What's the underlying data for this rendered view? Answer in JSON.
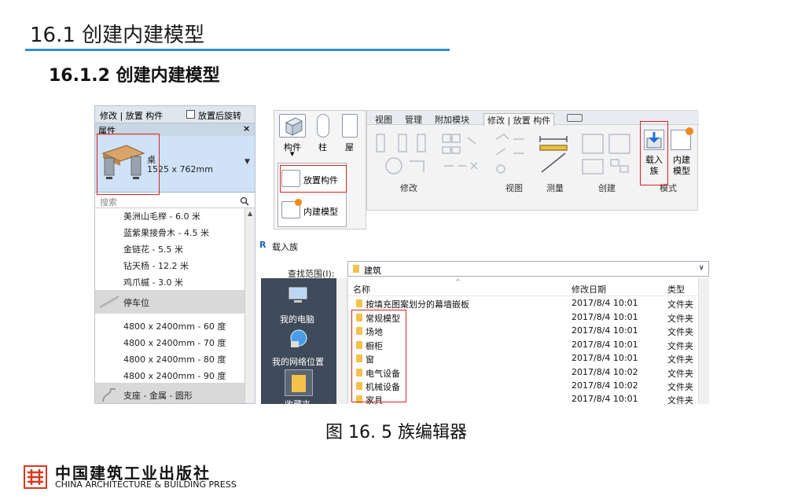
{
  "slide": {
    "title": "16.1 创建内建模型",
    "subtitle": "16.1.2 创建内建模型",
    "caption": "图 16. 5 族编辑器"
  },
  "props_panel": {
    "tab_label": "修改 | 放置 构件",
    "rotate_checkbox": "放置后旋转",
    "header": "属性",
    "close": "×",
    "type_name": "桌",
    "type_size": "1525 x 762mm",
    "search_placeholder": "搜索",
    "plants": [
      "美洲山毛榉 - 6.0 米",
      "蓝紫果接骨木 - 4.5 米",
      "金链花 - 5.5 米",
      "钻天杨 - 12.2 米",
      "鸡爪槭 - 3.0 米"
    ],
    "group_parking": "停车位",
    "parking": [
      "4800 x 2400mm - 60 度",
      "4800 x 2400mm - 70 度",
      "4800 x 2400mm - 80 度",
      "4800 x 2400mm - 90 度"
    ],
    "group_toilet": "支座 - 金属 - 圆形"
  },
  "ribbon_small": {
    "component": "构件",
    "column": "柱",
    "third": "屋",
    "place_component": "放置构件",
    "inplace_model": "内建模型"
  },
  "ribbon_main": {
    "tabs": [
      "视图",
      "管理",
      "附加模块",
      "修改 | 放置 构件"
    ],
    "groups": [
      "修改",
      "视图",
      "测量",
      "创建",
      "模式"
    ],
    "load_family": "载入族",
    "inplace_model": "内建模型"
  },
  "dialog": {
    "icon": "R",
    "title": "载入族",
    "lookin_label": "查找范围(I):",
    "lookin_value": "建筑",
    "places": [
      "我的电脑",
      "我的网络位置",
      "收藏夹"
    ],
    "columns": [
      "名称",
      "修改日期",
      "类型"
    ],
    "rows": [
      {
        "name": "按填充图案划分的幕墙嵌板",
        "date": "2017/8/4 10:01",
        "type": "文件夹"
      },
      {
        "name": "常规模型",
        "date": "2017/8/4 10:01",
        "type": "文件夹"
      },
      {
        "name": "场地",
        "date": "2017/8/4 10:01",
        "type": "文件夹"
      },
      {
        "name": "橱柜",
        "date": "2017/8/4 10:01",
        "type": "文件夹"
      },
      {
        "name": "窗",
        "date": "2017/8/4 10:01",
        "type": "文件夹"
      },
      {
        "name": "电气设备",
        "date": "2017/8/4 10:02",
        "type": "文件夹"
      },
      {
        "name": "机械设备",
        "date": "2017/8/4 10:02",
        "type": "文件夹"
      },
      {
        "name": "家具",
        "date": "2017/8/4 10:01",
        "type": "文件夹"
      }
    ]
  },
  "publisher": {
    "cn": "中国建筑工业出版社",
    "en": "CHINA ARCHITECTURE & BUILDING PRESS"
  },
  "colors": {
    "accent_rule": "#2f8fd8",
    "highlight_box": "#e02020",
    "folder": "#f4c24a",
    "logo": "#d9381e"
  }
}
